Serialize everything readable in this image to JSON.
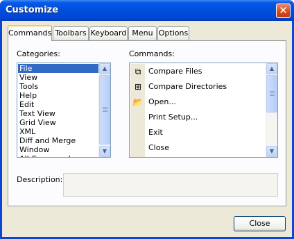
{
  "window": {
    "title": "Customize",
    "close_glyph": "✕"
  },
  "tabs": [
    {
      "label": "Commands",
      "active": true
    },
    {
      "label": "Toolbars",
      "active": false
    },
    {
      "label": "Keyboard",
      "active": false
    },
    {
      "label": "Menu",
      "active": false
    },
    {
      "label": "Options",
      "active": false
    }
  ],
  "categories": {
    "label": "Categories:",
    "selected": "File",
    "items": [
      "File",
      "View",
      "Tools",
      "Help",
      "Edit",
      "Text View",
      "Grid View",
      "XML",
      "Diff and Merge",
      "Window",
      "All Commands"
    ]
  },
  "commands": {
    "label": "Commands:",
    "items": [
      {
        "label": "Compare Files",
        "icon": "compare-files-icon",
        "glyph": "⧉"
      },
      {
        "label": "Compare Directories",
        "icon": "compare-directories-icon",
        "glyph": "⊞"
      },
      {
        "label": "Open...",
        "icon": "open-folder-icon",
        "glyph": "📂"
      },
      {
        "label": "Print Setup...",
        "icon": "",
        "glyph": ""
      },
      {
        "label": "Exit",
        "icon": "",
        "glyph": ""
      },
      {
        "label": "Close",
        "icon": "",
        "glyph": ""
      }
    ]
  },
  "description": {
    "label": "Description:",
    "value": ""
  },
  "buttons": {
    "close": "Close"
  },
  "scroll": {
    "up": "▲",
    "down": "▼"
  },
  "colors": {
    "titlebar": "#0050e0",
    "selection": "#316ac5",
    "face": "#ece9d8",
    "tab_highlight": "#ffc83c"
  }
}
